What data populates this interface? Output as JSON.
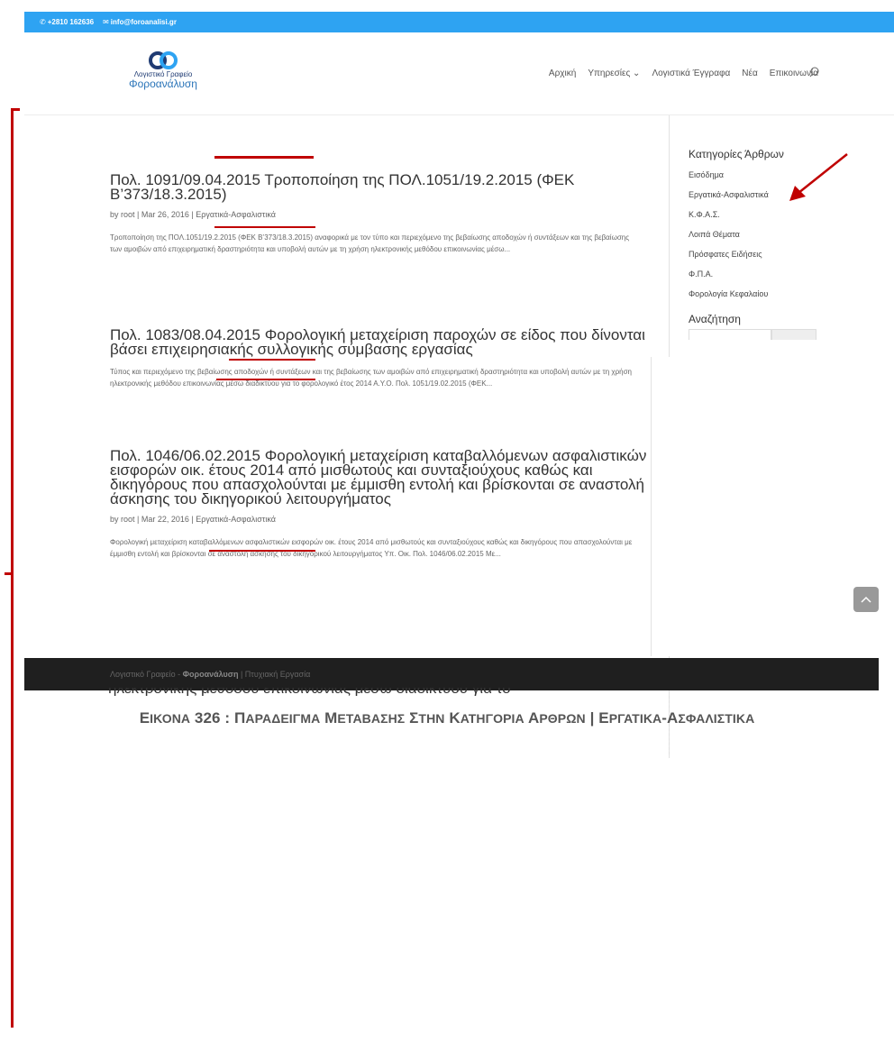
{
  "topbar": {
    "phone": "+2810 162636",
    "email": "info@foroanalisi.gr"
  },
  "logo": {
    "line1": "Λογιστικό Γραφείο",
    "line2": "Φοροανάλυση"
  },
  "nav": {
    "items": [
      "Αρχική",
      "Υπηρεσίες",
      "Λογιστικά Έγγραφα",
      "Νέα",
      "Επικοινωνία"
    ]
  },
  "posts": [
    {
      "title": "Πολ. 1091/09.04.2015 Τροποποίηση της ΠΟΛ.1051/19.2.2015 (ΦΕΚ Β’373/18.3.2015)",
      "meta_prefix": "by root | Mar 26, 2016 | ",
      "category": "Εργατικά-Ασφαλιστικά",
      "excerpt": "Τροποποίηση της ΠΟΛ.1051/19.2.2015 (ΦΕΚ Β’373/18.3.2015) αναφορικά με τον τύπο και περιεχόμενο της βεβαίωσης αποδοχών ή συντάξεων και της βεβαίωσης των αμοιβών από επιχειρηματική δραστηριότητα και υποβολή αυτών με τη χρήση ηλεκτρονικής μεθόδου επικοινωνίας μέσω..."
    },
    {
      "title": "Πολ. 1083/08.04.2015 Φορολογική μεταχείριση παροχών σε είδος που δίνονται βάσει επιχειρησιακής συλλογικής σύμβασης εργασίας",
      "excerpt": "Τύπος και περιεχόμενο της βεβαίωσης αποδοχών ή συντάξεων και της βεβαίωσης των αμοιβών από επιχειρηματική δραστηριότητα και υποβολή αυτών με τη χρήση ηλεκτρονικής μεθόδου επικοινωνίας μέσω διαδικτύου για το φορολογικό έτος 2014 Α.Υ.Ο. Πολ. 1051/19.02.2015 (ΦΕΚ..."
    },
    {
      "title": "Πολ. 1046/06.02.2015 Φορολογική μεταχείριση καταβαλλόμενων ασφαλιστικών εισφορών οικ. έτους 2014 από μισθωτούς και συνταξιούχους καθώς και δικηγόρους που απασχολούνται με έμμισθη εντολή και βρίσκονται σε αναστολή άσκησης του δικηγορικού λειτουργήματος",
      "meta_prefix": "by root | Mar 22, 2016 | ",
      "category": "Εργατικά-Ασφαλιστικά",
      "excerpt": "Φορολογική μεταχείριση καταβαλλόμενων ασφαλιστικών εισφορών οικ. έτους 2014 από μισθωτούς και συνταξιούχους καθώς και δικηγόρους που απασχολούνται με έμμισθη εντολή και βρίσκονται σε αναστολή άσκησης του δικηγορικού λειτουργήματος Υπ. Οικ. Πολ. 1046/06.02.2015 Με..."
    }
  ],
  "sidebar": {
    "categories_title": "Κατηγορίες Άρθρων",
    "categories": [
      "Εισόδημα",
      "Εργατικά-Ασφαλιστικά",
      "Κ.Φ.Α.Σ.",
      "Λοιπά Θέματα",
      "Πρόσφατες Ειδήσεις",
      "Φ.Π.Α.",
      "Φορολογία Κεφαλαίου"
    ],
    "search_title": "Αναζήτηση"
  },
  "footer": {
    "prefix": "Λογιστικό Γραφείο - ",
    "brand": "Φοροανάλυση",
    "suffix": " | Πτυχιακή Εργασία"
  },
  "bleed_text": "ηλεκτρονικής μεθόδου επικοινωνίας μέσω διαδικτύου για το",
  "caption": {
    "prefix": "Ε",
    "small1": "ΙΚΟΝΑ",
    "num": " 326 : Π",
    "small2": "ΑΡΑΔΕΙΓΜΑ",
    "m1": " Μ",
    "small3": "ΕΤΑΒΑΣΗΣ",
    "m2": " Σ",
    "small4": "ΤΗΝ",
    "m3": " Κ",
    "small5": "ΑΤΗΓΟΡΙΑ",
    "m4": " Α",
    "small6": "ΡΘΡΩΝ",
    "m5": " | Ε",
    "small7": "ΡΓΑΤΙΚΑ",
    "m6": "-Α",
    "small8": "ΣΦΑΛΙΣΤΙΚΑ"
  },
  "colors": {
    "topbar": "#2ea3f2",
    "annotation": "#c00000",
    "footer": "#1f1f1f"
  }
}
